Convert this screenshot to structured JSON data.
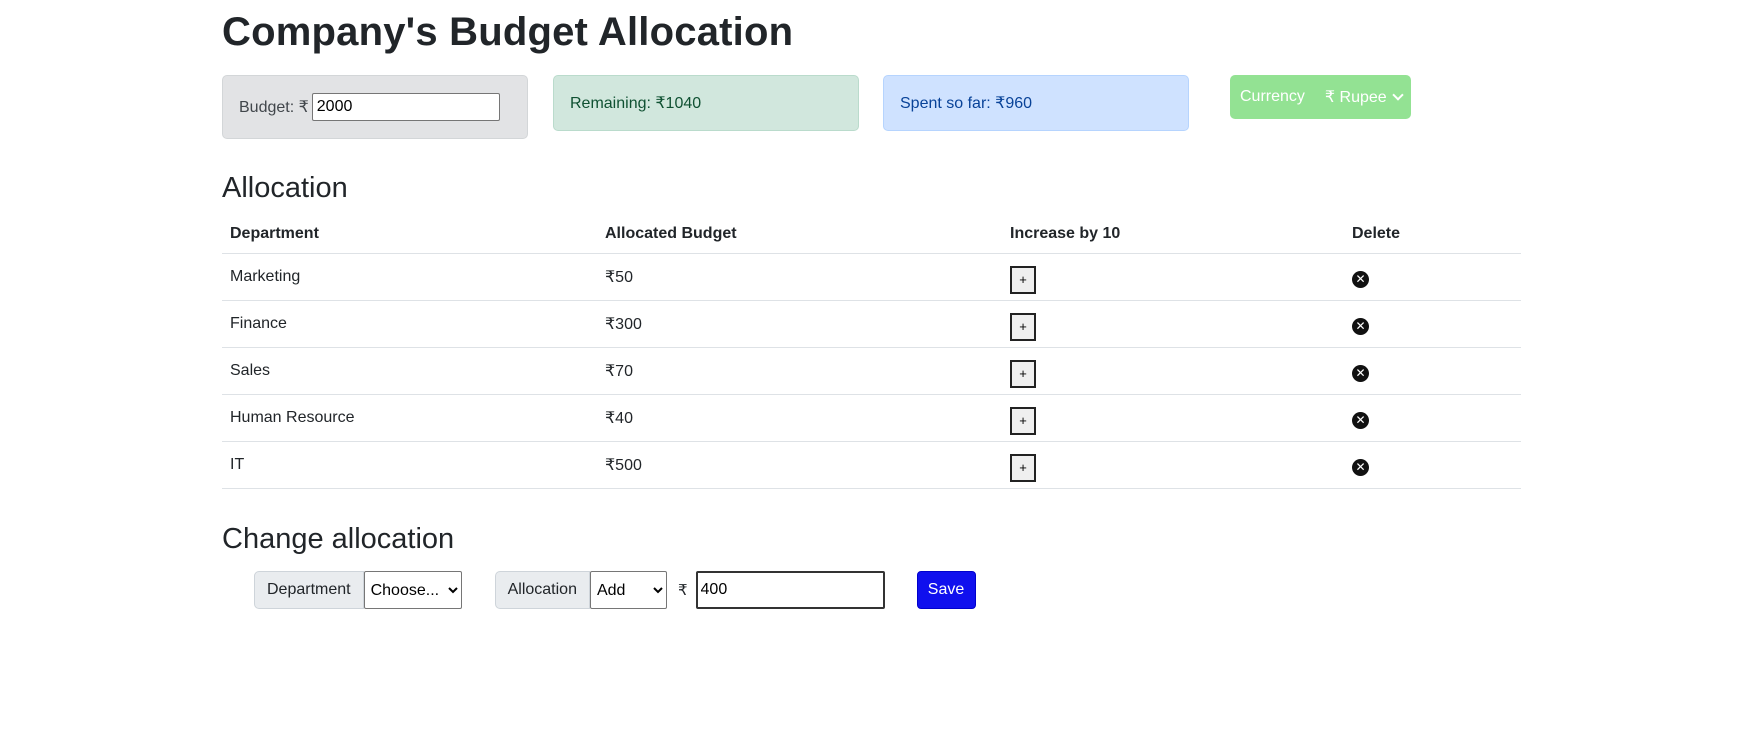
{
  "title": "Company's Budget Allocation",
  "summary": {
    "budget_label": "Budget: ₹",
    "budget_value": "2000",
    "remaining": "Remaining: ₹1040",
    "spent": "Spent so far: ₹960"
  },
  "currency": {
    "label": "Currency",
    "value": "₹ Rupee"
  },
  "allocation": {
    "heading": "Allocation",
    "columns": [
      "Department",
      "Allocated Budget",
      "Increase by 10",
      "Delete"
    ],
    "rows": [
      {
        "department": "Marketing",
        "budget": "₹50",
        "increase": "+"
      },
      {
        "department": "Finance",
        "budget": "₹300",
        "increase": "+"
      },
      {
        "department": "Sales",
        "budget": "₹70",
        "increase": "+"
      },
      {
        "department": "Human Resource",
        "budget": "₹40",
        "increase": "+"
      },
      {
        "department": "IT",
        "budget": "₹500",
        "increase": "+"
      }
    ]
  },
  "change": {
    "heading": "Change allocation",
    "department_label": "Department",
    "department_selected": "Choose...",
    "allocation_label": "Allocation",
    "allocation_selected": "Add",
    "currency_symbol": "₹",
    "amount": "400",
    "save_label": "Save"
  },
  "colors": {
    "budget_box": "#e2e3e5",
    "remaining_box": "#d1e7dd",
    "spent_box": "#cfe2ff",
    "currency_box": "#93e293",
    "save_button": "#1010ee"
  }
}
